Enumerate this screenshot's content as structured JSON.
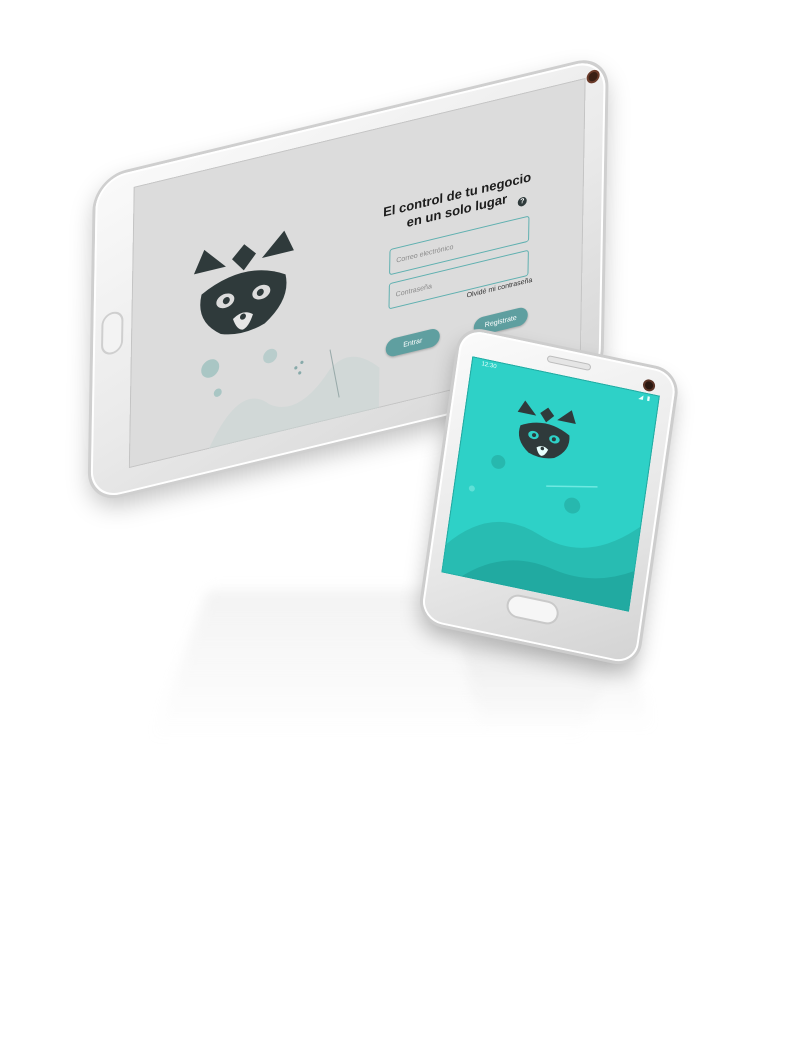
{
  "tablet": {
    "title_line1": "El control de tu negocio",
    "title_line2": "en un solo lugar",
    "help_icon": "question-circle-icon",
    "help_glyph": "?",
    "email_placeholder": "Correo electrónico",
    "password_placeholder": "Contraseña",
    "forgot_password": "Olvidé mi contraseña",
    "login_button": "Entrar",
    "register_button": "Registrate",
    "logo_icon": "raccoon-logo-icon"
  },
  "phone": {
    "status_time": "12:30",
    "status_icons": "◢ ▮",
    "logo_icon": "raccoon-logo-icon"
  },
  "colors": {
    "teal_accent": "#5fb0b0",
    "button_teal": "#5f9fa0",
    "phone_screen": "#2ed1c7",
    "tablet_screen": "#dcdcdc",
    "logo_dark": "#2f3a3b"
  }
}
